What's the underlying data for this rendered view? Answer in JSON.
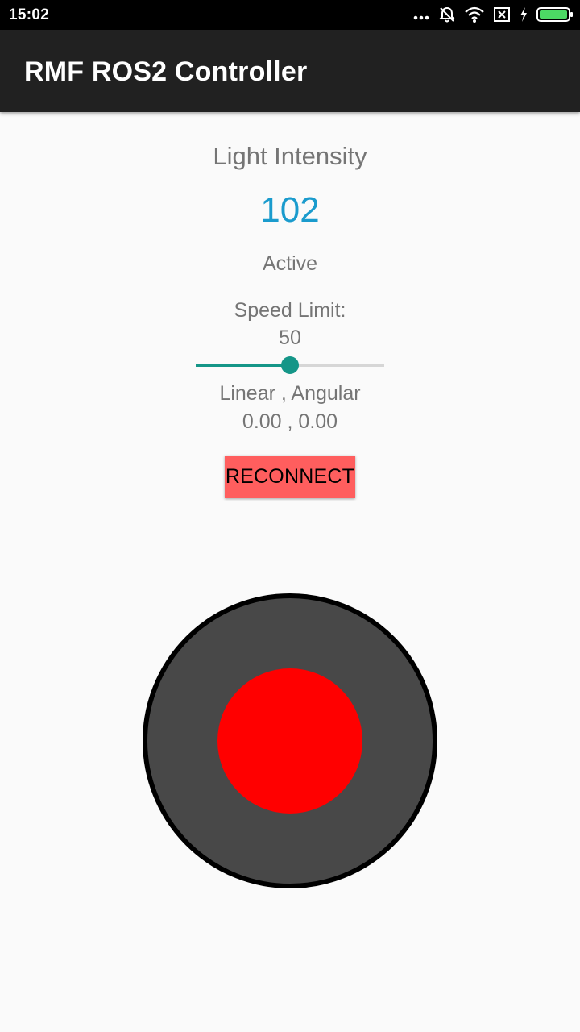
{
  "status_bar": {
    "time": "15:02",
    "icons": [
      "more-dots-icon",
      "alarm-off-icon",
      "wifi-icon",
      "sim-x-icon",
      "charging-icon",
      "battery-icon"
    ]
  },
  "app_bar": {
    "title": "RMF ROS2 Controller"
  },
  "sensor": {
    "label": "Light Intensity",
    "value": "102"
  },
  "status": {
    "text": "Active"
  },
  "speed": {
    "label": "Speed Limit:",
    "value_text": "50",
    "slider_fraction": 0.5
  },
  "velocity": {
    "label": "Linear , Angular",
    "value": "0.00 , 0.00"
  },
  "reconnect": {
    "label": "RECONNECT"
  },
  "colors": {
    "accent": "#159688",
    "value_blue": "#1a9bcd",
    "button_red": "#ff5e5e",
    "joystick_base": "#484848",
    "joystick_knob": "#ff0000"
  }
}
